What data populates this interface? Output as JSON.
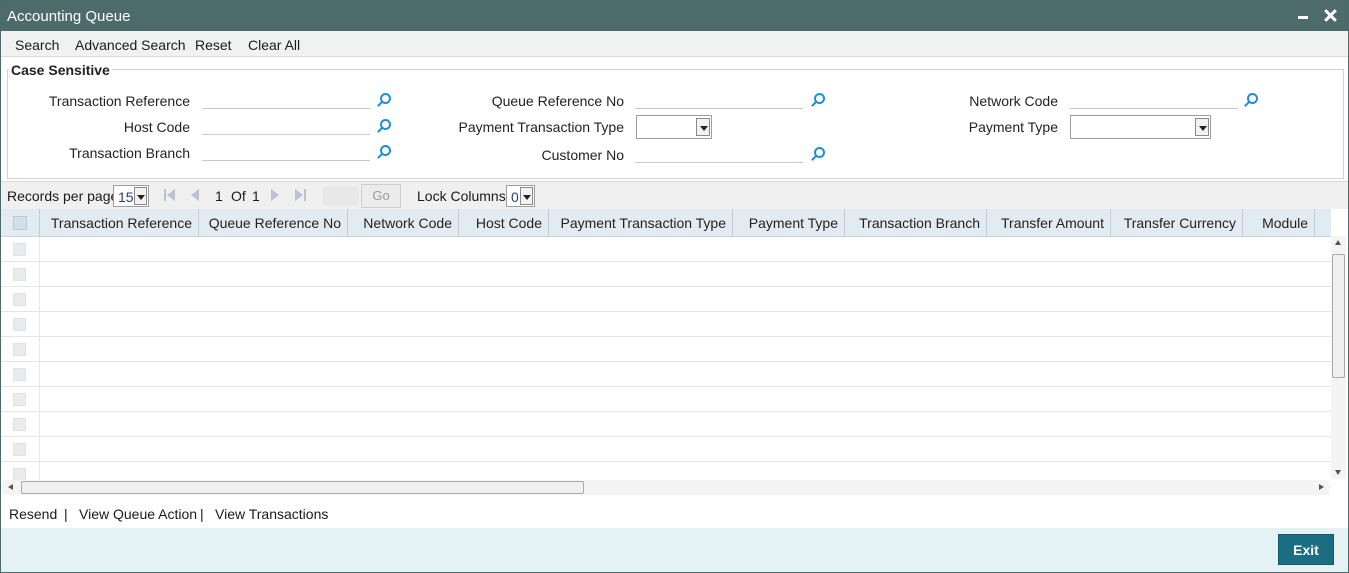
{
  "window": {
    "title": "Accounting Queue"
  },
  "menu": {
    "search": "Search",
    "advanced_search": "Advanced Search",
    "reset": "Reset",
    "clear_all": "Clear All"
  },
  "criteria": {
    "legend": "Case Sensitive",
    "transaction_reference": {
      "label": "Transaction Reference",
      "value": ""
    },
    "host_code": {
      "label": "Host Code",
      "value": ""
    },
    "transaction_branch": {
      "label": "Transaction Branch",
      "value": ""
    },
    "queue_reference_no": {
      "label": "Queue Reference No",
      "value": ""
    },
    "payment_transaction_type": {
      "label": "Payment Transaction Type",
      "value": ""
    },
    "customer_no": {
      "label": "Customer No",
      "value": ""
    },
    "network_code": {
      "label": "Network Code",
      "value": ""
    },
    "payment_type": {
      "label": "Payment Type",
      "value": ""
    }
  },
  "pager": {
    "records_per_page_label": "Records per page",
    "records_per_page": "15",
    "current_page": "1",
    "of_label": "Of",
    "total_pages": "1",
    "go_label": "Go",
    "lock_columns_label": "Lock Columns",
    "lock_columns": "0"
  },
  "grid": {
    "columns": [
      "Transaction Reference",
      "Queue Reference No",
      "Network Code",
      "Host Code",
      "Payment Transaction Type",
      "Payment Type",
      "Transaction Branch",
      "Transfer Amount",
      "Transfer Currency",
      "Module"
    ],
    "row_count_visible": 10,
    "rows": []
  },
  "actions": {
    "resend": "Resend",
    "sep1": "|",
    "view_queue_action": "View Queue Action",
    "sep2": "|",
    "view_transactions": "View Transactions"
  },
  "footer": {
    "exit": "Exit"
  },
  "colors": {
    "titlebar": "#4e6b6b",
    "accent": "#1b6d81",
    "search_icon": "#1e8fd6",
    "footer_bg": "#e5f2f4"
  }
}
